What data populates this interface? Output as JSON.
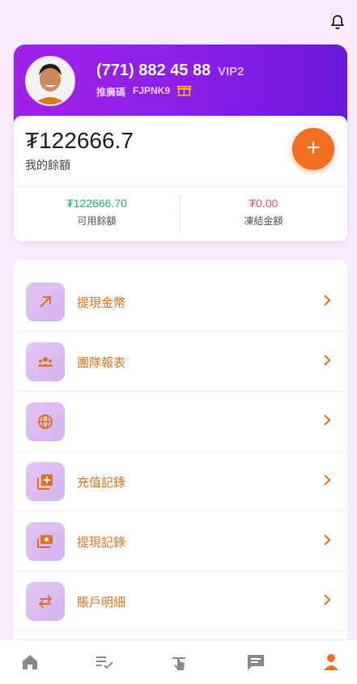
{
  "profile": {
    "phone": "(771) 882 45 88",
    "vip": "VIP2",
    "referral_label": "推廣碼",
    "referral_code": "FJPNK9"
  },
  "balance": {
    "amount": "₮122666.7",
    "label": "我的餘額",
    "available_value": "₮122666.70",
    "available_label": "可用餘額",
    "frozen_value": "₮0.00",
    "frozen_label": "凍結金額",
    "add_label": "+"
  },
  "menu": [
    {
      "label": "提現金幣",
      "icon": "arrow-up-right-icon"
    },
    {
      "label": "團隊報表",
      "icon": "team-icon"
    },
    {
      "label": "",
      "icon": "globe-icon"
    },
    {
      "label": "充值記錄",
      "icon": "add-library-icon"
    },
    {
      "label": "提現記錄",
      "icon": "cash-icon"
    },
    {
      "label": "賬戶明細",
      "icon": "swap-icon"
    }
  ],
  "tabs": [
    {
      "name": "home-tab",
      "icon": "home-icon",
      "active": false
    },
    {
      "name": "tasks-tab",
      "icon": "checklist-icon",
      "active": false
    },
    {
      "name": "grab-tab",
      "icon": "tap-icon",
      "active": false
    },
    {
      "name": "messages-tab",
      "icon": "chat-icon",
      "active": false
    },
    {
      "name": "profile-tab",
      "icon": "person-icon",
      "active": true
    }
  ],
  "colors": {
    "accent": "#f26f21",
    "menu_text": "#e0731a",
    "available": "#19b37a",
    "frozen": "#ea4d57",
    "card_gradient_start": "#a021e8",
    "card_gradient_end": "#6b18dd"
  }
}
